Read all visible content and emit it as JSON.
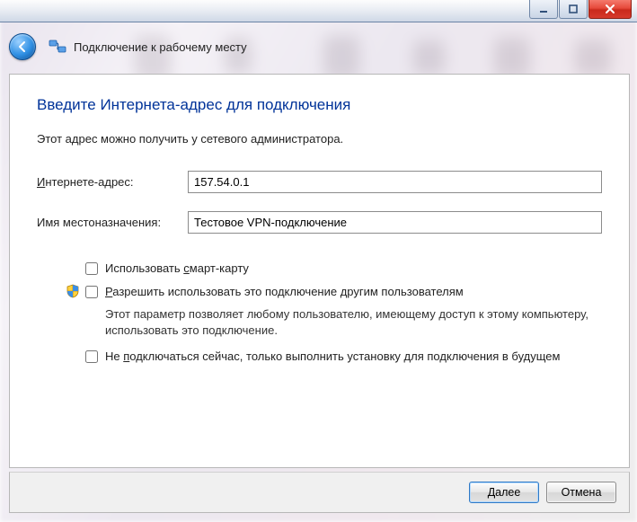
{
  "header": {
    "wizard_title": "Подключение к рабочему месту"
  },
  "panel": {
    "title": "Введите Интернета-адрес для подключения",
    "subtitle": "Этот адрес можно получить у сетевого администратора."
  },
  "form": {
    "internet_address": {
      "label_pre": "И",
      "label_rest": "нтернете-адрес:",
      "value": "157.54.0.1"
    },
    "destination_name": {
      "label": "Имя местоназначения:",
      "value": "Тестовое VPN-подключение"
    }
  },
  "checks": {
    "smartcard": {
      "label_pre": "Использовать ",
      "label_u": "с",
      "label_rest": "март-карту",
      "checked": false
    },
    "allow_others": {
      "label_u": "Р",
      "label_rest": "азрешить использовать это подключение другим пользователям",
      "checked": false,
      "desc": "Этот параметр позволяет любому пользователю, имеющему доступ к этому компьютеру, использовать это подключение."
    },
    "dont_connect_now": {
      "label_pre": "Не ",
      "label_u": "п",
      "label_rest": "одключаться сейчас, только выполнить установку для подключения в будущем",
      "checked": false
    }
  },
  "footer": {
    "next": "Далее",
    "cancel": "Отмена"
  }
}
